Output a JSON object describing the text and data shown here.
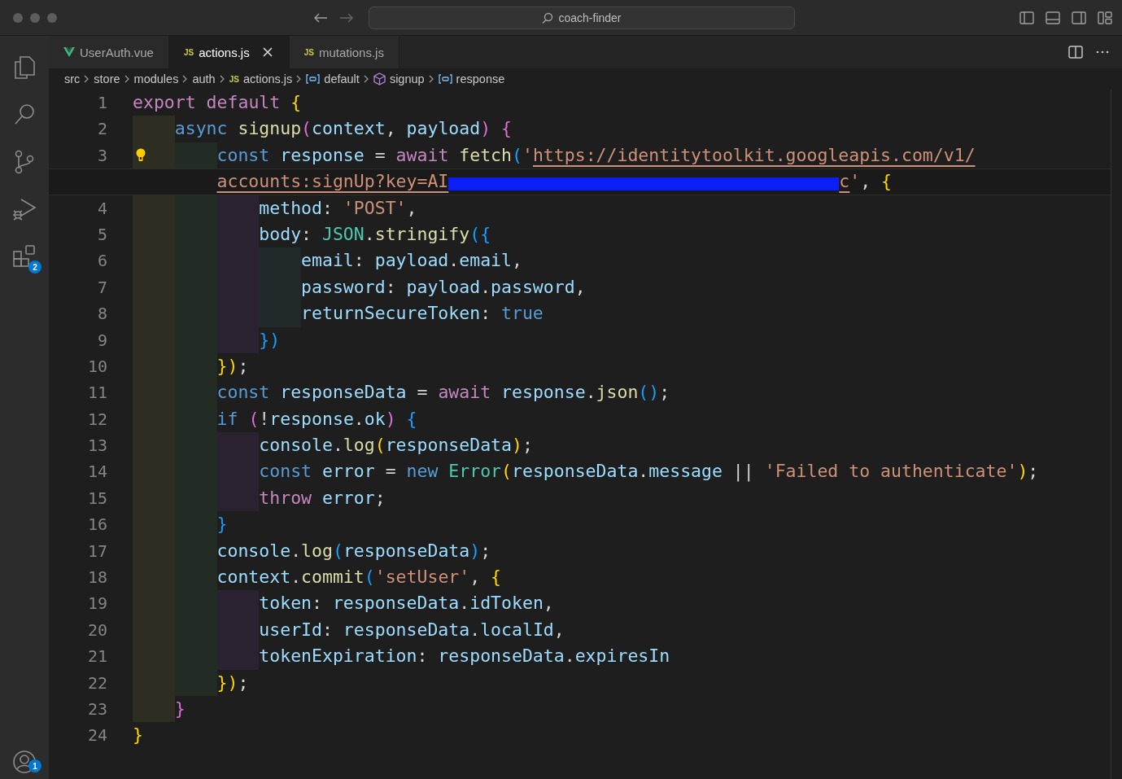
{
  "window": {
    "search": "coach-finder"
  },
  "activity_bar": {
    "extensions_badge": "2",
    "accounts_badge": "1"
  },
  "tabs": [
    {
      "label": "UserAuth.vue",
      "kind": "vue",
      "selected": false
    },
    {
      "label": "actions.js",
      "kind": "js",
      "icon_text": "JS",
      "selected": true
    },
    {
      "label": "mutations.js",
      "kind": "js",
      "icon_text": "JS",
      "selected": false
    }
  ],
  "breadcrumbs": [
    {
      "label": "src",
      "kind": "folder"
    },
    {
      "label": "store",
      "kind": "folder"
    },
    {
      "label": "modules",
      "kind": "folder"
    },
    {
      "label": "auth",
      "kind": "folder"
    },
    {
      "label": "actions.js",
      "kind": "js",
      "icon_text": "JS"
    },
    {
      "label": "default",
      "kind": "variable"
    },
    {
      "label": "signup",
      "kind": "method"
    },
    {
      "label": "response",
      "kind": "variable"
    }
  ],
  "editor": {
    "lines": [
      {
        "number": "1",
        "rows": [
          [
            {
              "kind": "kw",
              "text": "export default "
            },
            {
              "kind": "b1",
              "text": "{"
            }
          ]
        ]
      },
      {
        "number": "2",
        "rows": [
          [
            {
              "kind": "st",
              "text": "    async "
            },
            {
              "kind": "fn",
              "text": "signup"
            },
            {
              "kind": "b2",
              "text": "("
            },
            {
              "kind": "var",
              "text": "context"
            },
            {
              "kind": "pl",
              "text": ", "
            },
            {
              "kind": "var",
              "text": "payload"
            },
            {
              "kind": "b2",
              "text": ")"
            },
            {
              "kind": "pl",
              "text": " "
            },
            {
              "kind": "b2",
              "text": "{"
            }
          ]
        ]
      },
      {
        "number": "3",
        "lightbulb": true,
        "rows": [
          [
            {
              "kind": "st",
              "text": "        const "
            },
            {
              "kind": "var",
              "text": "response"
            },
            {
              "kind": "pl",
              "text": " = "
            },
            {
              "kind": "kw",
              "text": "await "
            },
            {
              "kind": "fn",
              "text": "fetch"
            },
            {
              "kind": "b3",
              "text": "("
            },
            {
              "kind": "str",
              "text": "'"
            },
            {
              "kind": "url",
              "text": "https://identitytoolkit.googleapis.com/v1/"
            }
          ]
        ]
      },
      {
        "current": true,
        "rows": [
          [
            {
              "kind": "url",
              "text": "accounts:signUp?key=AI"
            },
            {
              "kind": "redaction"
            },
            {
              "kind": "url",
              "text": "c"
            },
            {
              "kind": "str",
              "text": "'"
            },
            {
              "kind": "pl",
              "text": ", "
            },
            {
              "kind": "b1",
              "text": "{"
            }
          ]
        ]
      },
      {
        "number": "4",
        "rows": [
          [
            {
              "kind": "prop",
              "text": "            method"
            },
            {
              "kind": "pl",
              "text": ": "
            },
            {
              "kind": "str",
              "text": "'POST'"
            },
            {
              "kind": "pl",
              "text": ","
            }
          ]
        ]
      },
      {
        "number": "5",
        "rows": [
          [
            {
              "kind": "prop",
              "text": "            body"
            },
            {
              "kind": "pl",
              "text": ": "
            },
            {
              "kind": "cls",
              "text": "JSON"
            },
            {
              "kind": "pl",
              "text": "."
            },
            {
              "kind": "fn",
              "text": "stringify"
            },
            {
              "kind": "b3",
              "text": "("
            },
            {
              "kind": "b3",
              "text": "{"
            }
          ]
        ]
      },
      {
        "number": "6",
        "rows": [
          [
            {
              "kind": "prop",
              "text": "                email"
            },
            {
              "kind": "pl",
              "text": ": "
            },
            {
              "kind": "var",
              "text": "payload"
            },
            {
              "kind": "pl",
              "text": "."
            },
            {
              "kind": "var",
              "text": "email"
            },
            {
              "kind": "pl",
              "text": ","
            }
          ]
        ]
      },
      {
        "number": "7",
        "rows": [
          [
            {
              "kind": "prop",
              "text": "                password"
            },
            {
              "kind": "pl",
              "text": ": "
            },
            {
              "kind": "var",
              "text": "payload"
            },
            {
              "kind": "pl",
              "text": "."
            },
            {
              "kind": "var",
              "text": "password"
            },
            {
              "kind": "pl",
              "text": ","
            }
          ]
        ]
      },
      {
        "number": "8",
        "rows": [
          [
            {
              "kind": "prop",
              "text": "                returnSecureToken"
            },
            {
              "kind": "pl",
              "text": ": "
            },
            {
              "kind": "st",
              "text": "true"
            }
          ]
        ]
      },
      {
        "number": "9",
        "rows": [
          [
            {
              "kind": "b3",
              "text": "            })"
            }
          ]
        ]
      },
      {
        "number": "10",
        "rows": [
          [
            {
              "kind": "b1",
              "text": "        })"
            },
            {
              "kind": "pl",
              "text": ";"
            }
          ]
        ]
      },
      {
        "number": "11",
        "rows": [
          [
            {
              "kind": "st",
              "text": "        const "
            },
            {
              "kind": "var",
              "text": "responseData"
            },
            {
              "kind": "pl",
              "text": " = "
            },
            {
              "kind": "kw",
              "text": "await "
            },
            {
              "kind": "var",
              "text": "response"
            },
            {
              "kind": "pl",
              "text": "."
            },
            {
              "kind": "fn",
              "text": "json"
            },
            {
              "kind": "b3",
              "text": "()"
            },
            {
              "kind": "pl",
              "text": ";"
            }
          ]
        ]
      },
      {
        "number": "12",
        "rows": [
          [
            {
              "kind": "st",
              "text": "        if "
            },
            {
              "kind": "b2",
              "text": "("
            },
            {
              "kind": "pl",
              "text": "!"
            },
            {
              "kind": "var",
              "text": "response"
            },
            {
              "kind": "pl",
              "text": "."
            },
            {
              "kind": "var",
              "text": "ok"
            },
            {
              "kind": "b2",
              "text": ")"
            },
            {
              "kind": "pl",
              "text": " "
            },
            {
              "kind": "b3",
              "text": "{"
            }
          ]
        ]
      },
      {
        "number": "13",
        "rows": [
          [
            {
              "kind": "prop",
              "text": "            console"
            },
            {
              "kind": "pl",
              "text": "."
            },
            {
              "kind": "fn",
              "text": "log"
            },
            {
              "kind": "b1",
              "text": "("
            },
            {
              "kind": "var",
              "text": "responseData"
            },
            {
              "kind": "b1",
              "text": ")"
            },
            {
              "kind": "pl",
              "text": ";"
            }
          ]
        ]
      },
      {
        "number": "14",
        "rows": [
          [
            {
              "kind": "st",
              "text": "            const "
            },
            {
              "kind": "var",
              "text": "error"
            },
            {
              "kind": "pl",
              "text": " = "
            },
            {
              "kind": "st",
              "text": "new "
            },
            {
              "kind": "cls",
              "text": "Error"
            },
            {
              "kind": "b1",
              "text": "("
            },
            {
              "kind": "var",
              "text": "responseData"
            },
            {
              "kind": "pl",
              "text": "."
            },
            {
              "kind": "var",
              "text": "message"
            },
            {
              "kind": "pl",
              "text": " || "
            },
            {
              "kind": "str",
              "text": "'Failed to authenticate'"
            },
            {
              "kind": "b1",
              "text": ")"
            },
            {
              "kind": "pl",
              "text": ";"
            }
          ]
        ]
      },
      {
        "number": "15",
        "rows": [
          [
            {
              "kind": "kw",
              "text": "            throw "
            },
            {
              "kind": "var",
              "text": "error"
            },
            {
              "kind": "pl",
              "text": ";"
            }
          ]
        ]
      },
      {
        "number": "16",
        "rows": [
          [
            {
              "kind": "b3",
              "text": "        }"
            }
          ]
        ]
      },
      {
        "number": "17",
        "rows": [
          [
            {
              "kind": "prop",
              "text": "        console"
            },
            {
              "kind": "pl",
              "text": "."
            },
            {
              "kind": "fn",
              "text": "log"
            },
            {
              "kind": "b3",
              "text": "("
            },
            {
              "kind": "var",
              "text": "responseData"
            },
            {
              "kind": "b3",
              "text": ")"
            },
            {
              "kind": "pl",
              "text": ";"
            }
          ]
        ]
      },
      {
        "number": "18",
        "rows": [
          [
            {
              "kind": "prop",
              "text": "        context"
            },
            {
              "kind": "pl",
              "text": "."
            },
            {
              "kind": "fn",
              "text": "commit"
            },
            {
              "kind": "b3",
              "text": "("
            },
            {
              "kind": "str",
              "text": "'setUser'"
            },
            {
              "kind": "pl",
              "text": ", "
            },
            {
              "kind": "b1",
              "text": "{"
            }
          ]
        ]
      },
      {
        "number": "19",
        "rows": [
          [
            {
              "kind": "prop",
              "text": "            token"
            },
            {
              "kind": "pl",
              "text": ": "
            },
            {
              "kind": "var",
              "text": "responseData"
            },
            {
              "kind": "pl",
              "text": "."
            },
            {
              "kind": "prop",
              "text": "idToken"
            },
            {
              "kind": "pl",
              "text": ","
            }
          ]
        ]
      },
      {
        "number": "20",
        "rows": [
          [
            {
              "kind": "prop",
              "text": "            userId"
            },
            {
              "kind": "pl",
              "text": ": "
            },
            {
              "kind": "var",
              "text": "responseData"
            },
            {
              "kind": "pl",
              "text": "."
            },
            {
              "kind": "prop",
              "text": "localId"
            },
            {
              "kind": "pl",
              "text": ","
            }
          ]
        ]
      },
      {
        "number": "21",
        "rows": [
          [
            {
              "kind": "prop",
              "text": "            tokenExpiration"
            },
            {
              "kind": "pl",
              "text": ": "
            },
            {
              "kind": "var",
              "text": "responseData"
            },
            {
              "kind": "pl",
              "text": "."
            },
            {
              "kind": "prop",
              "text": "expiresIn"
            }
          ]
        ]
      },
      {
        "number": "22",
        "rows": [
          [
            {
              "kind": "b1",
              "text": "        })"
            },
            {
              "kind": "pl",
              "text": ";"
            }
          ]
        ]
      },
      {
        "number": "23",
        "rows": [
          [
            {
              "kind": "b2",
              "text": "    }"
            }
          ]
        ]
      },
      {
        "number": "24",
        "rows": [
          [
            {
              "kind": "b1",
              "text": "}"
            }
          ]
        ]
      }
    ]
  }
}
